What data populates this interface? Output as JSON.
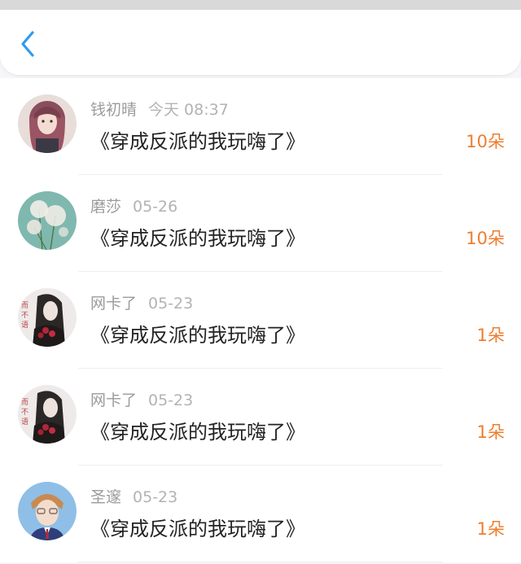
{
  "colors": {
    "accent": "#2e9bf0",
    "amount": "#ef7d2e",
    "title": "#222222",
    "meta": "#9b9b9b"
  },
  "header": {
    "back_icon": "chevron-left-icon"
  },
  "gifts": [
    {
      "user": "钱初晴",
      "time": "今天 08:37",
      "book": "《穿成反派的我玩嗨了》",
      "amount": "10朵",
      "avatar": "girl-portrait"
    },
    {
      "user": "磨莎",
      "time": "05-26",
      "book": "《穿成反派的我玩嗨了》",
      "amount": "10朵",
      "avatar": "dandelion"
    },
    {
      "user": "网卡了",
      "time": "05-23",
      "book": "《穿成反派的我玩嗨了》",
      "amount": "1朵",
      "avatar": "ink-character"
    },
    {
      "user": "网卡了",
      "time": "05-23",
      "book": "《穿成反派的我玩嗨了》",
      "amount": "1朵",
      "avatar": "ink-character"
    },
    {
      "user": "圣邃",
      "time": "05-23",
      "book": "《穿成反派的我玩嗨了》",
      "amount": "1朵",
      "avatar": "boy-portrait"
    }
  ]
}
